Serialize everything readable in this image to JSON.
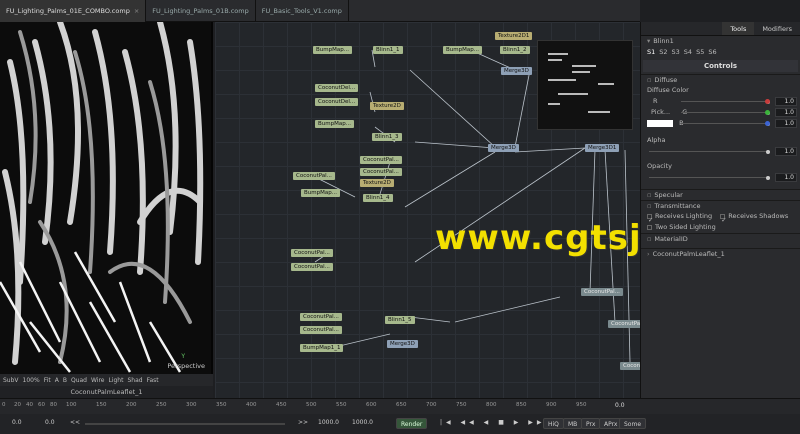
{
  "tabs": [
    {
      "label": "FU_Lighting_Palms_01E_COMBO.comp",
      "active": true
    },
    {
      "label": "FU_Lighting_Palms_01B.comp",
      "active": false
    },
    {
      "label": "FU_Basic_Tools_V1.comp",
      "active": false
    }
  ],
  "viewer": {
    "mode": "Perspective",
    "axis": "Y",
    "toolbar": [
      "SubV",
      "100%",
      "Fit",
      "A",
      "B",
      "Quad",
      "Wire",
      "Light",
      "Shad",
      "Fast"
    ],
    "caption": "CoconutPalmLeaflet_1"
  },
  "flow": {
    "nodes": [
      {
        "label": "BumpMap...",
        "color": "g"
      },
      {
        "label": "Blinn1_1",
        "color": "g"
      },
      {
        "label": "BumpMap...",
        "color": "g"
      },
      {
        "label": "Texture2D1",
        "color": "y"
      },
      {
        "label": "Blinn1_2",
        "color": "g"
      },
      {
        "label": "Merge3D",
        "color": "b"
      },
      {
        "label": "CoconutDel...",
        "color": "g"
      },
      {
        "label": "CoconutDel...",
        "color": "g"
      },
      {
        "label": "Texture2D",
        "color": "y"
      },
      {
        "label": "BumpMap...",
        "color": "g"
      },
      {
        "label": "Blinn1_3",
        "color": "g"
      },
      {
        "label": "CoconutPal...",
        "color": "g"
      },
      {
        "label": "BumpMap...",
        "color": "g"
      },
      {
        "label": "CoconutPal...",
        "color": "g"
      },
      {
        "label": "Texture2D",
        "color": "y"
      },
      {
        "label": "Blinn1_4",
        "color": "g"
      },
      {
        "label": "CoconutPal...",
        "color": "g"
      },
      {
        "label": "CoconutPal...",
        "color": "g"
      },
      {
        "label": "CoconutPal...",
        "color": "g"
      },
      {
        "label": "Merge3D",
        "color": "b"
      },
      {
        "label": "Merge3D1",
        "color": "b"
      },
      {
        "label": "CoconutPal...",
        "color": "g"
      },
      {
        "label": "CoconutPal...",
        "color": "g"
      },
      {
        "label": "BumpMap1_1",
        "color": "g"
      },
      {
        "label": "Blinn1_5",
        "color": "g"
      },
      {
        "label": "Merge3D",
        "color": "b"
      },
      {
        "label": "CoconutPal...",
        "color": "t"
      },
      {
        "label": "CoconutPal...",
        "color": "t"
      },
      {
        "label": "CoconutPal...",
        "color": "t"
      }
    ],
    "watermark": "www.cgtsj.com"
  },
  "inspector": {
    "tabs": [
      "Tools",
      "Modifiers"
    ],
    "tool_name": "Blinn1",
    "sets": [
      "S1",
      "S2",
      "S3",
      "S4",
      "S5",
      "S6"
    ],
    "controls_label": "Controls",
    "diffuse": "Diffuse",
    "diffuse_color": "Diffuse Color",
    "pick": "Pick...",
    "channels": [
      {
        "name": "R",
        "value": "1.0",
        "color": "#c83c3c"
      },
      {
        "name": "G",
        "value": "1.0",
        "color": "#3cb43c"
      },
      {
        "name": "B",
        "value": "1.0",
        "color": "#3c64d2"
      }
    ],
    "alpha_label": "Alpha",
    "alpha_value": "1.0",
    "opacity_label": "Opacity",
    "opacity_value": "1.0",
    "specular": "Specular",
    "transmittance": "Transmittance",
    "receives_lighting": "Receives Lighting",
    "receives_shadows": "Receives Shadows",
    "two_sided": "Two Sided Lighting",
    "material_id": "MaterialID",
    "next_tool": "CoconutPalmLeaflet_1"
  },
  "timeline": {
    "ticks": [
      "0",
      "20",
      "40",
      "60",
      "80",
      "100",
      "150",
      "200",
      "250",
      "300",
      "350",
      "400",
      "450",
      "500",
      "550",
      "600",
      "650",
      "700",
      "750",
      "800",
      "850",
      "900",
      "950"
    ],
    "end": "0.0"
  },
  "transport": {
    "start": "0.0",
    "current": "0.0",
    "end": "1000.0",
    "render_end": "1000.0",
    "render": "Render",
    "hiq": "HiQ",
    "mb": "MB",
    "prx": "Prx",
    "aprx": "APrx",
    "some": "Some"
  }
}
